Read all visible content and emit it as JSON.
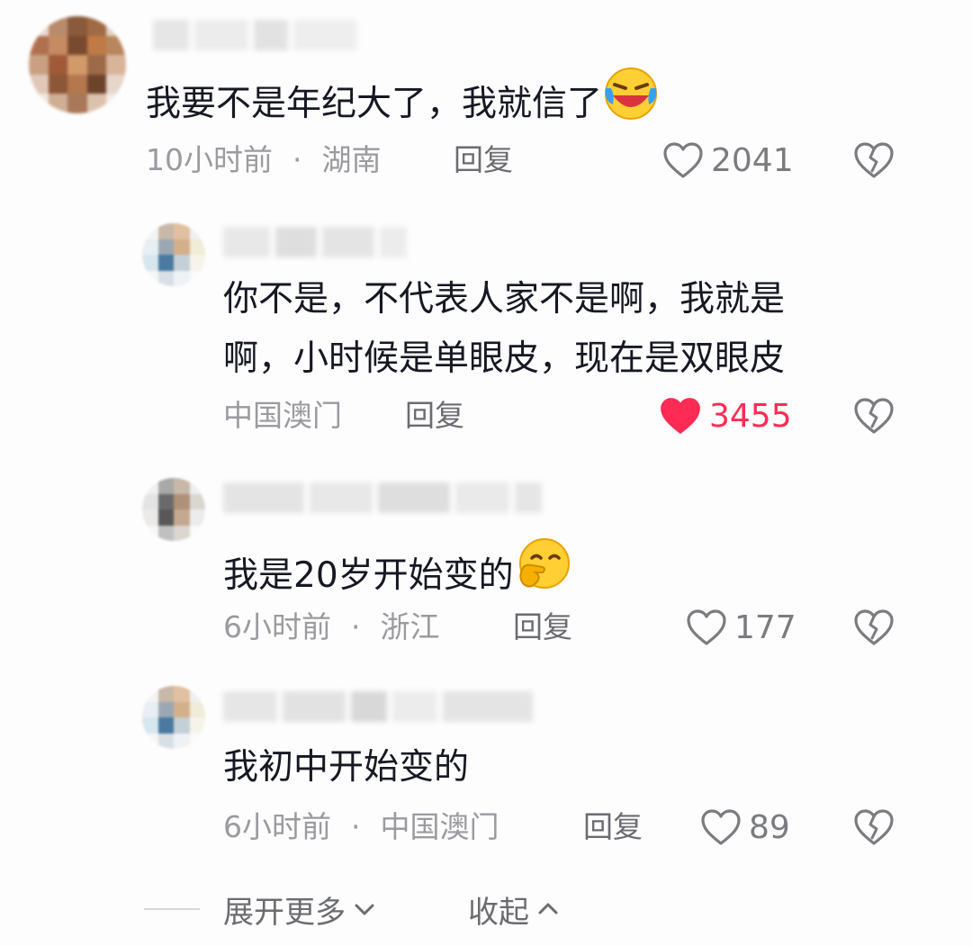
{
  "comments": [
    {
      "text": "我要不是年纪大了，我就信了",
      "time": "10小时前",
      "location": "湖南",
      "reply_label": "回复",
      "likes": "2041",
      "liked": false
    },
    {
      "text_line1": "你不是，不代表人家不是啊，我就是",
      "text_line2": "啊，小时候是单眼皮，现在是双眼皮",
      "location": "中国澳门",
      "reply_label": "回复",
      "likes": "3455",
      "liked": true
    },
    {
      "text": "我是20岁开始变的",
      "time": "6小时前",
      "location": "浙江",
      "reply_label": "回复",
      "likes": "177",
      "liked": false
    },
    {
      "text": "我初中开始变的",
      "time": "6小时前",
      "location": "中国澳门",
      "reply_label": "回复",
      "likes": "89",
      "liked": false
    }
  ],
  "footer": {
    "expand_label": "展开更多",
    "collapse_label": "收起"
  },
  "colors": {
    "like_active": "#fe2c55",
    "text_primary": "#161823",
    "text_secondary": "#9a9b9f"
  },
  "icons": [
    "heart-outline-icon",
    "heart-filled-icon",
    "broken-heart-icon",
    "chevron-down-icon",
    "chevron-up-icon",
    "laughing-crying-emoji",
    "hand-over-mouth-emoji"
  ]
}
